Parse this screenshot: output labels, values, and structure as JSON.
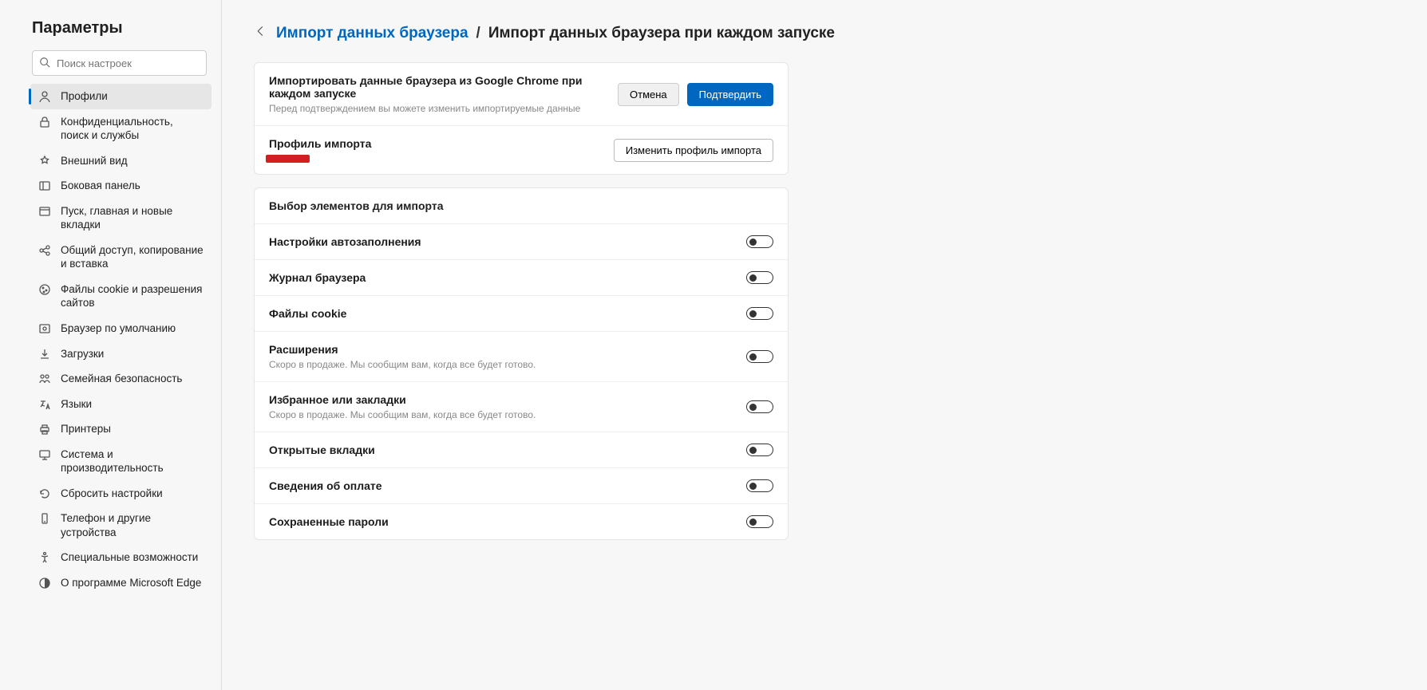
{
  "sidebar": {
    "title": "Параметры",
    "search_placeholder": "Поиск настроек",
    "items": [
      {
        "icon": "profile",
        "label": "Профили",
        "active": true
      },
      {
        "icon": "lock",
        "label": "Конфиденциальность, поиск и службы"
      },
      {
        "icon": "appearance",
        "label": "Внешний вид"
      },
      {
        "icon": "sidepanel",
        "label": "Боковая панель"
      },
      {
        "icon": "start",
        "label": "Пуск, главная и новые вкладки"
      },
      {
        "icon": "share",
        "label": "Общий доступ, копирование и вставка"
      },
      {
        "icon": "cookie",
        "label": "Файлы cookie и разрешения сайтов"
      },
      {
        "icon": "default-browser",
        "label": "Браузер по умолчанию"
      },
      {
        "icon": "download",
        "label": "Загрузки"
      },
      {
        "icon": "family",
        "label": "Семейная безопасность"
      },
      {
        "icon": "lang",
        "label": "Языки"
      },
      {
        "icon": "printer",
        "label": "Принтеры"
      },
      {
        "icon": "system",
        "label": "Система и производительность"
      },
      {
        "icon": "reset",
        "label": "Сбросить настройки"
      },
      {
        "icon": "phone",
        "label": "Телефон и другие устройства"
      },
      {
        "icon": "accessibility",
        "label": "Специальные возможности"
      },
      {
        "icon": "about",
        "label": "О программе Microsoft Edge"
      }
    ]
  },
  "breadcrumb": {
    "link": "Импорт данных браузера",
    "sep": "/",
    "current": "Импорт данных браузера при каждом запуске"
  },
  "header_row": {
    "title": "Импортировать данные браузера из Google Chrome при каждом запуске",
    "sub": "Перед подтверждением вы можете изменить импортируемые данные",
    "cancel": "Отмена",
    "confirm": "Подтвердить"
  },
  "profile_row": {
    "title": "Профиль импорта",
    "change": "Изменить профиль импорта"
  },
  "select_section": {
    "header": "Выбор элементов для импорта",
    "items": [
      {
        "title": "Настройки автозаполнения",
        "on": false
      },
      {
        "title": "Журнал браузера",
        "on": false
      },
      {
        "title": "Файлы cookie",
        "on": false
      },
      {
        "title": "Расширения",
        "sub": "Скоро в продаже. Мы сообщим вам, когда все будет готово.",
        "on": false
      },
      {
        "title": "Избранное или закладки",
        "sub": "Скоро в продаже. Мы сообщим вам, когда все будет готово.",
        "on": false
      },
      {
        "title": "Открытые вкладки",
        "on": false
      },
      {
        "title": "Сведения об оплате",
        "on": false
      },
      {
        "title": "Сохраненные пароли",
        "on": false
      }
    ]
  }
}
